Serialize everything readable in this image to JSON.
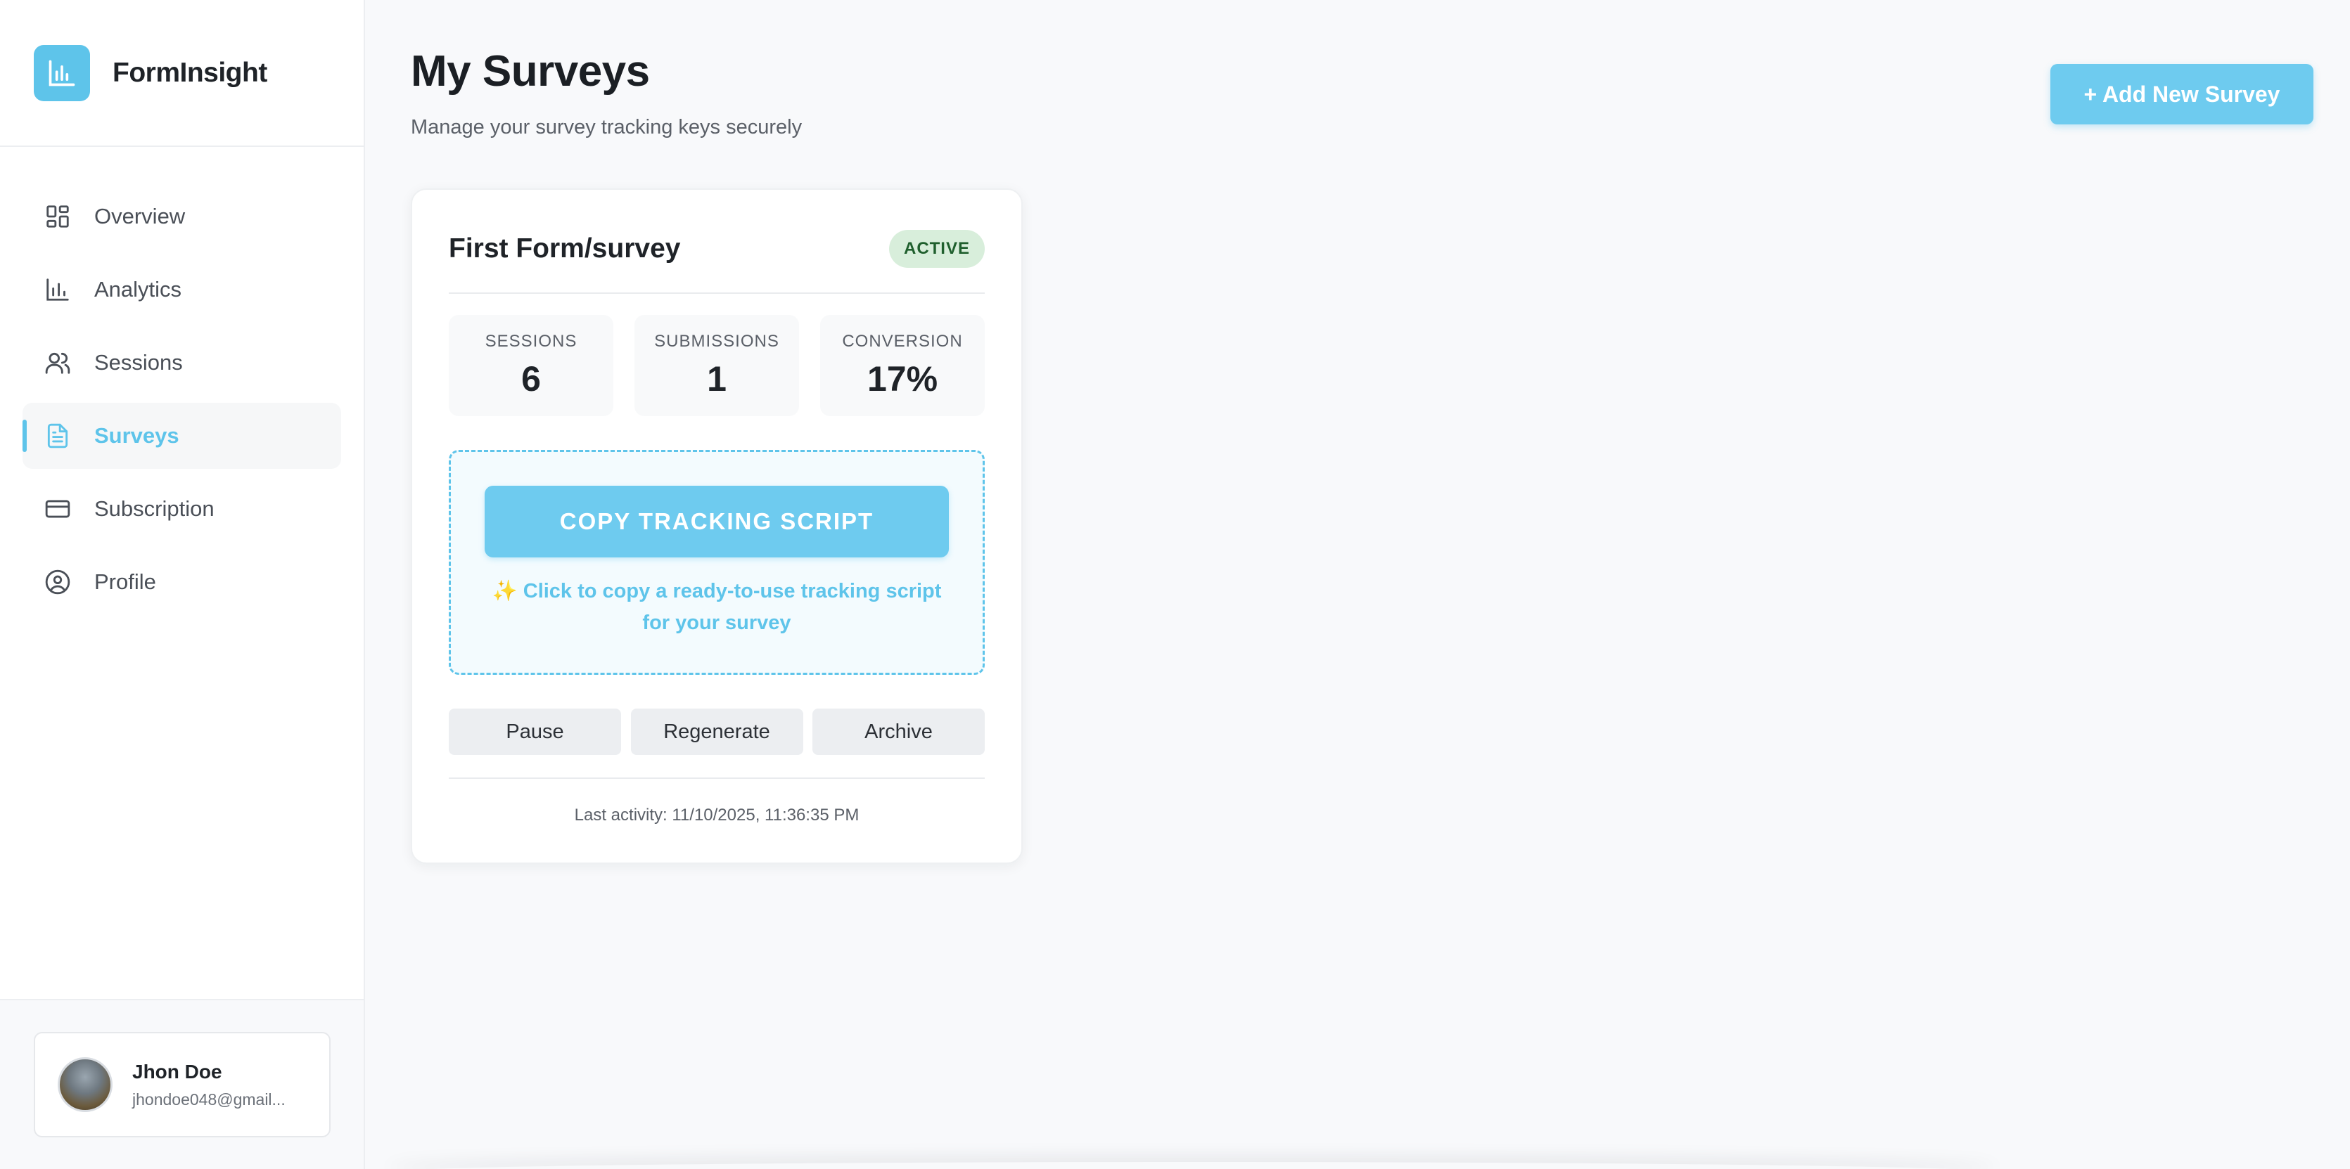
{
  "brand": {
    "name": "FormInsight"
  },
  "sidebar": {
    "items": [
      {
        "label": "Overview",
        "icon": "grid-icon"
      },
      {
        "label": "Analytics",
        "icon": "bar-chart-icon"
      },
      {
        "label": "Sessions",
        "icon": "users-icon"
      },
      {
        "label": "Surveys",
        "icon": "document-icon",
        "active": true
      },
      {
        "label": "Subscription",
        "icon": "credit-card-icon"
      },
      {
        "label": "Profile",
        "icon": "user-circle-icon"
      }
    ]
  },
  "user": {
    "name": "Jhon Doe",
    "email": "jhondoe048@gmail..."
  },
  "header": {
    "title": "My Surveys",
    "subtitle": "Manage your survey tracking keys securely",
    "add_label": "+ Add New Survey"
  },
  "survey": {
    "title": "First Form/survey",
    "status": "ACTIVE",
    "stats": [
      {
        "label": "SESSIONS",
        "value": "6"
      },
      {
        "label": "SUBMISSIONS",
        "value": "1"
      },
      {
        "label": "CONVERSION",
        "value": "17%"
      }
    ],
    "copy_label": "COPY TRACKING SCRIPT",
    "hint_icon": "✨",
    "hint": "Click to copy a ready-to-use tracking script for your survey",
    "actions": {
      "pause": "Pause",
      "regenerate": "Regenerate",
      "archive": "Archive"
    },
    "last_activity": "Last activity: 11/10/2025, 11:36:35 PM"
  },
  "colors": {
    "accent": "#5ec4ea",
    "badge_bg": "#d8eedb",
    "badge_text": "#1f5f2d"
  }
}
